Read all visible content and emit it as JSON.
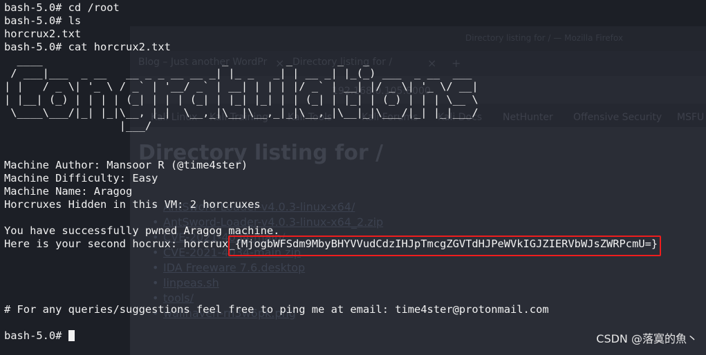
{
  "browser": {
    "window_title": "Directory listing for / — Mozilla Firefox",
    "tabs": [
      {
        "label": "Blog – Just another WordPr"
      },
      {
        "label": "Directory listing for /"
      }
    ],
    "url": "192.168.0.105:8000",
    "bookmarks": [
      "Kali Linux",
      "Kali Training",
      "Kali Tools",
      "Kali Forums",
      "Kali Docs",
      "NetHunter",
      "Offensive Security",
      "MSFU"
    ],
    "heading": "Directory listing for /",
    "files": [
      "AntSword-Loader-v4.0.3-linux-x64/",
      "AntSword-Loader-v4.0.3-linux-x64_2.zip",
      "CVE-2021-4034-main/",
      "CVE-2021-4034-main.zip",
      "IDA Freeware 7.6.desktop",
      "linpeas.sh",
      "tools/",
      "wallhaven-rn3w6pk.png"
    ]
  },
  "terminal": {
    "lines": [
      "bash-5.0# cd /root",
      "bash-5.0# ls",
      "horcrux2.txt",
      "bash-5.0# cat horcrux2.txt"
    ],
    "ascii_art": "  ____                            _         _       _   _                 \n / ___|___  _ __   __ _ _ __ __ _| |_ _   _| | __ _| |_(_) ___  _ __  ___ \n| |   / _ \\| '_ \\ / _` | '__/ _` | __| | | | |/ _` | __| |/ _ \\| '_ \\/ __|\n| |__| (_) | | | | (_| | | | (_| | |_| |_| | | (_| | |_| | (_) | | | \\__ \\\n \\____\\___/|_| |_|\\__, |_|  \\__,_|\\__|\\__,_|_|\\__,_|\\__|_|\\___/|_| |_|___/\n                  |___/                                                   ",
    "info": [
      "Machine Author: Mansoor R (@time4ster)",
      "Machine Difficulty: Easy",
      "Machine Name: Aragog",
      "Horcruxes Hidden in this VM: 2 horcruxes"
    ],
    "pwned": "You have successfully pwned Aragog machine.",
    "hocrux_prefix": "Here is your second hocrux: horcrux_",
    "flag": "{MjogbWFSdm9MbyBHYVVudCdzIHJpTmcgZGVTdHJPeWVkIGJZIERVbWJsZWRPcmU=}",
    "contact": "# For any queries/suggestions feel free to ping me at email: time4ster@protonmail.com",
    "prompt": "bash-5.0# "
  },
  "watermark": "CSDN @落寞的魚丶",
  "colors": {
    "highlight_box": "#f01d1d",
    "terminal_text": "#f2f2f2"
  }
}
